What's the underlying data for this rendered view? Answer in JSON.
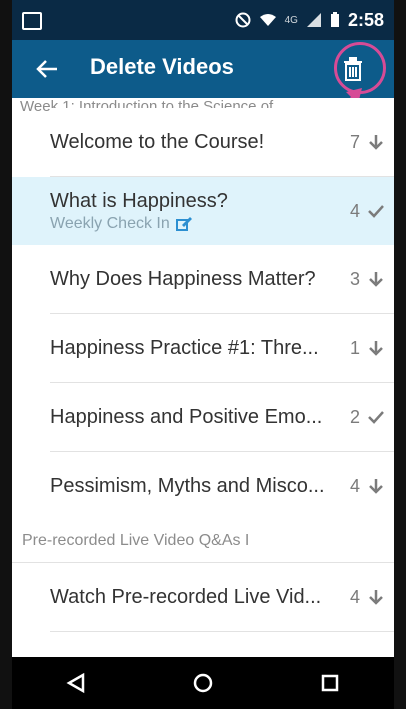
{
  "status": {
    "time": "2:58",
    "network": "4G",
    "icons": [
      "image-icon",
      "no-disturb-icon",
      "wifi-icon",
      "signal-icon",
      "battery-icon"
    ]
  },
  "appbar": {
    "title": "Delete Videos",
    "back_icon": "arrow-left-icon",
    "delete_icon": "trash-icon",
    "accent": "#0d5b8a",
    "highlight_ring": "#d64b96"
  },
  "list": {
    "peek_label": "Week 1: Introduction to the Science of",
    "items": [
      {
        "label": "Welcome to the Course!",
        "count": "7",
        "status": "download"
      },
      {
        "label": "What is Happiness?",
        "sub": "Weekly Check In",
        "count": "4",
        "status": "check",
        "selected": true
      },
      {
        "label": "Why Does Happiness Matter?",
        "count": "3",
        "status": "download"
      },
      {
        "label": "Happiness Practice #1: Thre...",
        "count": "1",
        "status": "download"
      },
      {
        "label": "Happiness and Positive Emo...",
        "count": "2",
        "status": "check"
      },
      {
        "label": "Pessimism, Myths and Misco...",
        "count": "4",
        "status": "download"
      }
    ],
    "section2": "Pre-recorded Live Video Q&As I",
    "items2": [
      {
        "label": "Watch Pre-recorded Live Vid...",
        "count": "4",
        "status": "download"
      }
    ]
  },
  "navbar": {
    "back": "back-triangle-icon",
    "home": "home-circle-icon",
    "recent": "recent-square-icon"
  }
}
